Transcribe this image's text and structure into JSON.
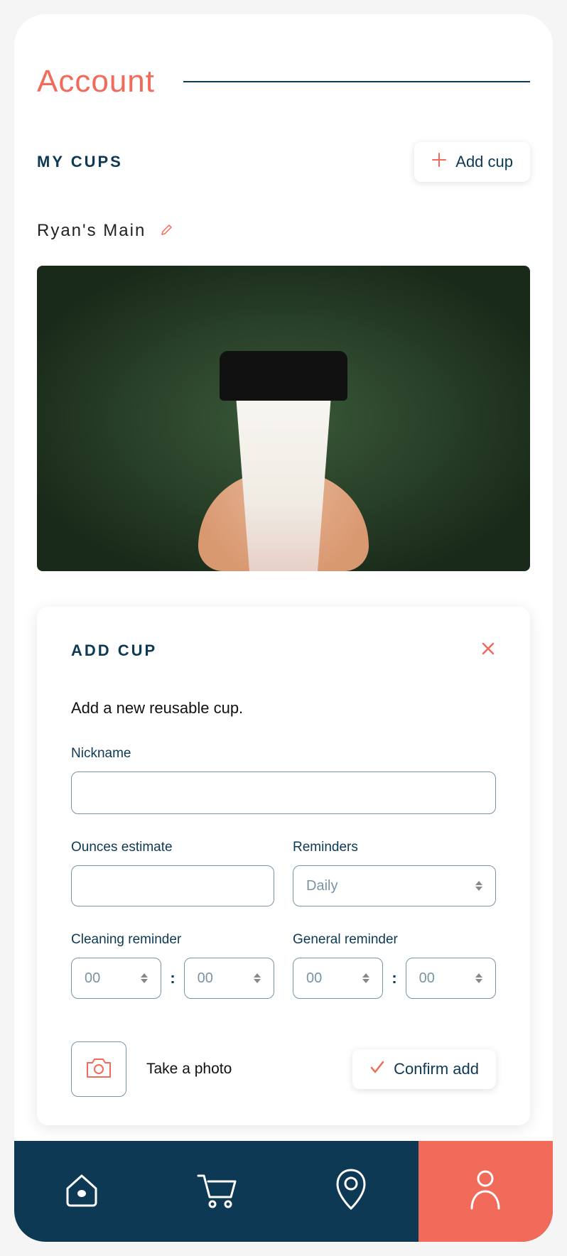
{
  "colors": {
    "accent": "#f26a5a",
    "primary": "#0d3954"
  },
  "page": {
    "title": "Account"
  },
  "cups": {
    "section_label": "MY CUPS",
    "add_button": "Add cup",
    "current_name": "Ryan's Main"
  },
  "form": {
    "title": "ADD CUP",
    "subtitle": "Add a new reusable cup.",
    "nickname_label": "Nickname",
    "nickname_value": "",
    "ounces_label": "Ounces estimate",
    "ounces_value": "",
    "reminders_label": "Reminders",
    "reminders_value": "Daily",
    "cleaning_label": "Cleaning reminder",
    "cleaning_hh": "00",
    "cleaning_mm": "00",
    "general_label": "General reminder",
    "general_hh": "00",
    "general_mm": "00",
    "photo_label": "Take a photo",
    "confirm_label": "Confirm add"
  },
  "nav": {
    "items": [
      "home",
      "cart",
      "location",
      "profile"
    ],
    "active": "profile"
  }
}
